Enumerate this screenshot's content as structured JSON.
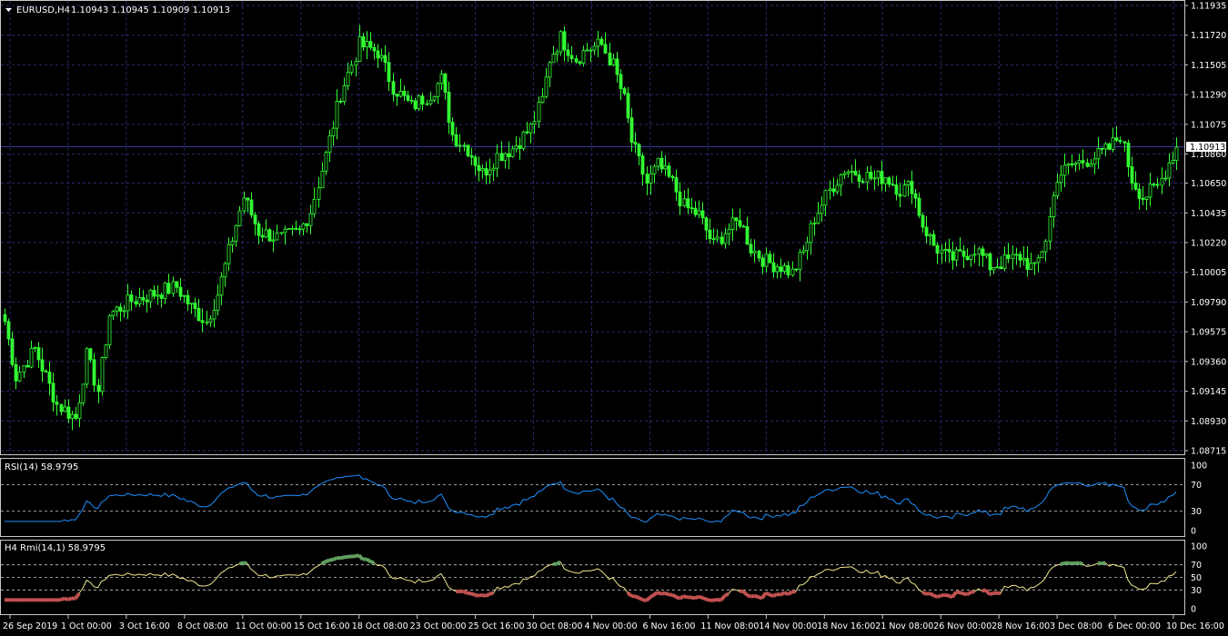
{
  "colors": {
    "background": "#000000",
    "grid": "#2a2a6a",
    "frame": "#c8c8c8",
    "candle_up": "#33ff33",
    "candle_down": "#33ff33",
    "price_line": "#3a3a9a",
    "rsi_line": "#1e90ff",
    "rmi_line": "#f0e68c",
    "rmi_overbought": "#5f9f5f",
    "rmi_oversold": "#c05050",
    "level_line": "#c8c8c8",
    "current_price_bg": "#ffffff",
    "text": "#ffffff"
  },
  "header": {
    "symbol": "EURUSD,H4",
    "ohlc": "1.10943 1.10945 1.10909 1.10913",
    "arrow_icon": "triangle-down-icon"
  },
  "current_price_label": "1.10913",
  "rsi_panel": {
    "title": "RSI(14) 58.9795"
  },
  "rmi_panel": {
    "title": "H4 Rmi(14,1) 58.9795"
  },
  "chart_data": [
    {
      "type": "candlestick",
      "symbol": "EURUSD",
      "timeframe": "H4",
      "ylim": [
        1.08715,
        1.11935
      ],
      "y_ticks": [
        "1.11935",
        "1.11720",
        "1.11505",
        "1.11290",
        "1.11075",
        "1.10860",
        "1.10650",
        "1.10435",
        "1.10220",
        "1.10005",
        "1.09790",
        "1.09575",
        "1.09360",
        "1.09145",
        "1.08930",
        "1.08715"
      ],
      "current_price": 1.10913,
      "x_ticks": [
        "26 Sep 2019",
        "1 Oct 00:00",
        "3 Oct 16:00",
        "8 Oct 08:00",
        "11 Oct 00:00",
        "15 Oct 16:00",
        "18 Oct 08:00",
        "23 Oct 00:00",
        "25 Oct 16:00",
        "30 Oct 08:00",
        "4 Nov 00:00",
        "6 Nov 16:00",
        "11 Nov 08:00",
        "14 Nov 00:00",
        "18 Nov 16:00",
        "21 Nov 08:00",
        "26 Nov 00:00",
        "28 Nov 16:00",
        "3 Dec 08:00",
        "6 Dec 00:00",
        "10 Dec 16:00"
      ],
      "close_anchors": [
        [
          0,
          1.0965
        ],
        [
          3,
          1.0925
        ],
        [
          8,
          1.0945
        ],
        [
          14,
          1.0905
        ],
        [
          19,
          1.0895
        ],
        [
          22,
          1.094
        ],
        [
          25,
          1.0915
        ],
        [
          28,
          1.097
        ],
        [
          34,
          1.098
        ],
        [
          40,
          1.0985
        ],
        [
          46,
          1.099
        ],
        [
          50,
          1.0975
        ],
        [
          54,
          1.0965
        ],
        [
          57,
          1.0985
        ],
        [
          61,
          1.1025
        ],
        [
          64,
          1.1055
        ],
        [
          68,
          1.103
        ],
        [
          74,
          1.1025
        ],
        [
          79,
          1.103
        ],
        [
          82,
          1.1045
        ],
        [
          86,
          1.1085
        ],
        [
          90,
          1.113
        ],
        [
          95,
          1.1165
        ],
        [
          100,
          1.116
        ],
        [
          104,
          1.1135
        ],
        [
          109,
          1.112
        ],
        [
          114,
          1.113
        ],
        [
          117,
          1.114
        ],
        [
          120,
          1.11
        ],
        [
          124,
          1.109
        ],
        [
          128,
          1.1072
        ],
        [
          132,
          1.1085
        ],
        [
          136,
          1.109
        ],
        [
          141,
          1.1105
        ],
        [
          144,
          1.1125
        ],
        [
          146,
          1.1155
        ],
        [
          149,
          1.117
        ],
        [
          153,
          1.1155
        ],
        [
          156,
          1.1162
        ],
        [
          160,
          1.1165
        ],
        [
          163,
          1.115
        ],
        [
          166,
          1.1125
        ],
        [
          168,
          1.1095
        ],
        [
          172,
          1.1065
        ],
        [
          175,
          1.1078
        ],
        [
          179,
          1.1065
        ],
        [
          182,
          1.1048
        ],
        [
          186,
          1.1042
        ],
        [
          190,
          1.102
        ],
        [
          193,
          1.103
        ],
        [
          197,
          1.1038
        ],
        [
          200,
          1.1018
        ],
        [
          204,
          1.1008
        ],
        [
          208,
          1.1005
        ],
        [
          211,
          1.1
        ],
        [
          214,
          1.1015
        ],
        [
          217,
          1.104
        ],
        [
          221,
          1.106
        ],
        [
          225,
          1.1075
        ],
        [
          229,
          1.1072
        ],
        [
          233,
          1.1068
        ],
        [
          236,
          1.107
        ],
        [
          240,
          1.106
        ],
        [
          243,
          1.1063
        ],
        [
          246,
          1.1035
        ],
        [
          249,
          1.102
        ],
        [
          253,
          1.101
        ],
        [
          257,
          1.1013
        ],
        [
          260,
          1.1018
        ],
        [
          264,
          1.1005
        ],
        [
          268,
          1.1008
        ],
        [
          272,
          1.1012
        ],
        [
          276,
          1.1002
        ],
        [
          279,
          1.1025
        ],
        [
          282,
          1.107
        ],
        [
          286,
          1.1078
        ],
        [
          290,
          1.1082
        ],
        [
          293,
          1.1085
        ],
        [
          296,
          1.109
        ],
        [
          299,
          1.11
        ],
        [
          302,
          1.1068
        ],
        [
          305,
          1.1055
        ],
        [
          309,
          1.1062
        ],
        [
          312,
          1.108
        ],
        [
          314,
          1.1091
        ]
      ],
      "candle_count": 315
    },
    {
      "type": "line",
      "name": "RSI(14)",
      "ylim": [
        0,
        100
      ],
      "y_ticks": [
        100,
        70,
        30,
        0
      ],
      "levels": [
        70,
        30
      ],
      "last_value": 58.9795
    },
    {
      "type": "line",
      "name": "H4 Rmi(14,1)",
      "ylim": [
        0,
        100
      ],
      "y_ticks": [
        100,
        70,
        50,
        30,
        0
      ],
      "levels": [
        70,
        50,
        30
      ],
      "last_value": 58.9795
    }
  ]
}
